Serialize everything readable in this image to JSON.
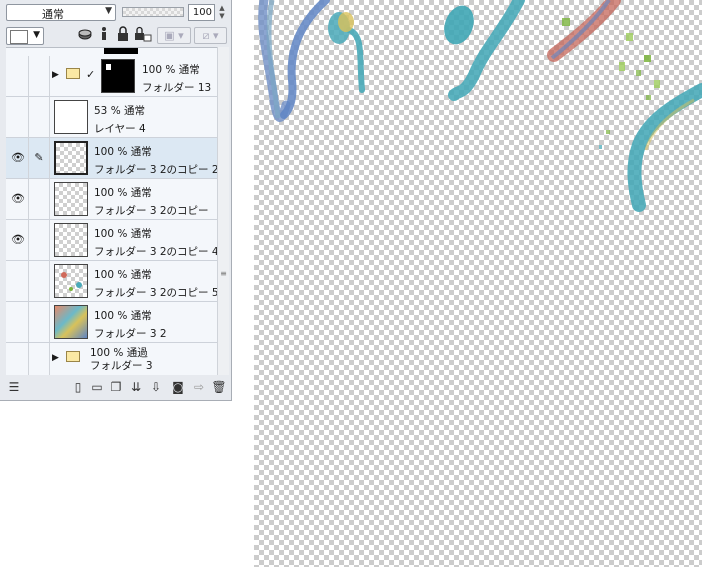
{
  "layer_panel": {
    "blend_mode": "通常",
    "opacity_value": "100",
    "layers": [
      {
        "opacity_mode": "100 % 通常",
        "name": "フォルダー 13",
        "kind": "folder",
        "expanded_arrow": "▶",
        "checked": true
      },
      {
        "opacity_mode": "53 % 通常",
        "name": "レイヤー 4",
        "kind": "layer"
      },
      {
        "opacity_mode": "100 % 通常",
        "name": "フォルダー 3 2のコピー 2",
        "kind": "layer",
        "selected": true,
        "visible": true,
        "editing": true
      },
      {
        "opacity_mode": "100 % 通常",
        "name": "フォルダー 3 2のコピー",
        "kind": "layer",
        "visible": true
      },
      {
        "opacity_mode": "100 % 通常",
        "name": "フォルダー 3 2のコピー 4",
        "kind": "layer",
        "visible": true
      },
      {
        "opacity_mode": "100 % 通常",
        "name": "フォルダー 3 2のコピー 5",
        "kind": "layer"
      },
      {
        "opacity_mode": "100 % 通常",
        "name": "フォルダー 3 2",
        "kind": "layer"
      },
      {
        "opacity_mode": "100 % 通過",
        "name": "フォルダー 3",
        "kind": "folder",
        "expanded_arrow": "▶"
      }
    ],
    "icons": {
      "visible": "eye-icon",
      "editing": "pencil-icon",
      "expand": "triangle-right-icon"
    }
  },
  "colors": {
    "panel_bg": "#e7eaef",
    "selected_row": "#dce8f3",
    "row_bg": "#f4f7fb",
    "stroke_teal": "#3fa6b5",
    "stroke_blue": "#5f85c4",
    "stroke_green": "#7bb43c",
    "stroke_red": "#c4665a"
  }
}
